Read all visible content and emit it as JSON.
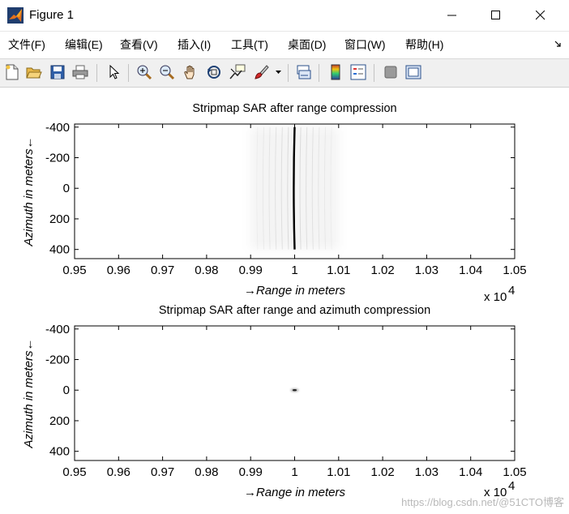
{
  "window": {
    "title": "Figure 1",
    "controls": {
      "minimize": "minimize",
      "maximize": "maximize",
      "close": "close"
    }
  },
  "menu": [
    {
      "label": "文件(F)"
    },
    {
      "label": "编辑(E)"
    },
    {
      "label": "查看(V)"
    },
    {
      "label": "插入(I)"
    },
    {
      "label": "工具(T)"
    },
    {
      "label": "桌面(D)"
    },
    {
      "label": "窗口(W)"
    },
    {
      "label": "帮助(H)"
    }
  ],
  "toolbar": {
    "icons": [
      "new-figure-icon",
      "open-file-icon",
      "save-icon",
      "print-icon",
      "select-arrow-icon",
      "zoom-in-icon",
      "zoom-out-icon",
      "pan-hand-icon",
      "rotate-3d-icon",
      "data-cursor-icon",
      "brush-icon",
      "dropdown-arrow-icon",
      "link-plot-icon",
      "colorbar-icon",
      "legend-icon",
      "hide-plot-tools-icon",
      "show-plot-tools-icon"
    ]
  },
  "chart_data": [
    {
      "type": "heatmap",
      "title": "Stripmap SAR after range compression",
      "xlabel": "→Range in meters",
      "ylabel": "Azimuth in meters←",
      "x_exponent": "x 10",
      "x_exponent_power": "4",
      "xlim": [
        0.95,
        1.05
      ],
      "ylim": [
        -420,
        460
      ],
      "y_reversed": true,
      "xticks": [
        "0.95",
        "0.96",
        "0.97",
        "0.98",
        "0.99",
        "1",
        "1.01",
        "1.02",
        "1.03",
        "1.04",
        "1.05"
      ],
      "yticks": [
        "-400",
        "-200",
        "0",
        "200",
        "400"
      ],
      "colormap": "gray (inverted)",
      "features": {
        "curve": "range migration curve",
        "x_center": 1.0,
        "x_at_edges": 1.0,
        "x_at_zero": 0.9998,
        "y_range": [
          -400,
          400
        ],
        "sidelobe_spread": [
          0.99,
          1.01
        ]
      }
    },
    {
      "type": "heatmap",
      "title": "Stripmap SAR after range and azimuth compression",
      "xlabel": "→Range in meters",
      "ylabel": "Azimuth in meters←",
      "x_exponent": "x 10",
      "x_exponent_power": "4",
      "xlim": [
        0.95,
        1.05
      ],
      "ylim": [
        -420,
        460
      ],
      "y_reversed": true,
      "xticks": [
        "0.95",
        "0.96",
        "0.97",
        "0.98",
        "0.99",
        "1",
        "1.01",
        "1.02",
        "1.03",
        "1.04",
        "1.05"
      ],
      "yticks": [
        "-400",
        "-200",
        "0",
        "200",
        "400"
      ],
      "colormap": "gray (inverted)",
      "features": {
        "point_target": {
          "x": 1.0,
          "y": 0
        }
      }
    }
  ],
  "watermark": "https://blog.csdn.net/@51CTO博客"
}
